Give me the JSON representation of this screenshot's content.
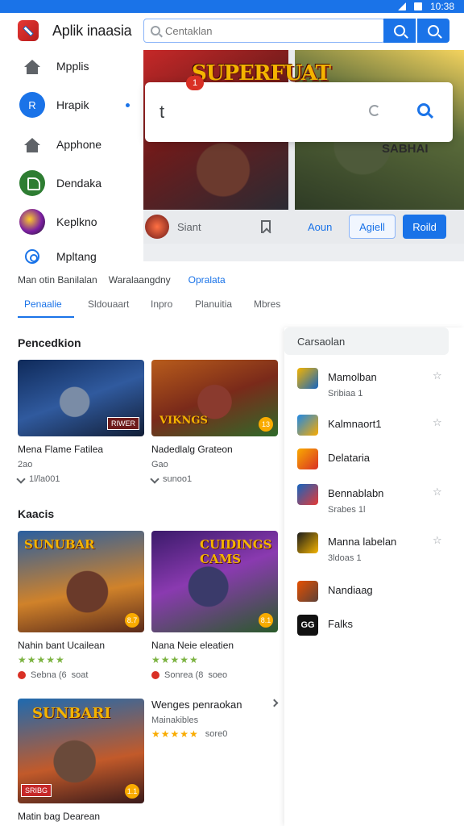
{
  "status_bar": {
    "time": "10:38"
  },
  "header": {
    "app_title": "Aplik inaasia"
  },
  "search": {
    "placeholder": "Centaklan"
  },
  "sidebar": {
    "items": [
      {
        "label": "Mpplis",
        "icon": "home-icon"
      },
      {
        "label": "Hrapik",
        "icon": "profile-circle-icon",
        "initial": "R"
      },
      {
        "label": "Apphone",
        "icon": "home-icon"
      },
      {
        "label": "Dendaka",
        "icon": "green-app-icon"
      },
      {
        "label": "Keplkno",
        "icon": "game-avatar-icon"
      },
      {
        "label": "Mpltang",
        "icon": "settings-icon"
      }
    ]
  },
  "hero": {
    "logo_text": "SUPERFUAT",
    "sub_text": "SABHAI",
    "name": "Siant",
    "link": "Aoun",
    "outline_button": "Agiell",
    "primary_button": "Roild"
  },
  "popup": {
    "badge": "1",
    "letter": "t"
  },
  "filters": [
    "Man otin Banilalan",
    "Waralaangdny",
    "Opralata"
  ],
  "tabs": [
    "Penaalie",
    "Sldouaart",
    "Inpro",
    "Planuitia",
    "Mbres"
  ],
  "sections": [
    {
      "title": "Pencedkion",
      "cards": [
        {
          "title": "Mena Flame Fatilea",
          "meta": "2ao",
          "downloads": "1l/la001",
          "tag": "RIWER"
        },
        {
          "title": "Nadedlalg Grateon",
          "meta": "Gao",
          "downloads": "sunoo1",
          "tag": "VIKNGS",
          "rating": "13"
        }
      ]
    },
    {
      "title": "Kaacis",
      "cards": [
        {
          "title": "Nahin bant Ucailean",
          "art": "SUNUBAR",
          "stars": "★★★★★",
          "rating_line": "Sebna (6",
          "extra": "soat",
          "badge": "8.7"
        },
        {
          "title": "Nana Neie eleatien",
          "art": "CUIDINGS CAMS",
          "stars": "★★★★★",
          "rating_line": "Sonrea (8",
          "extra": "soeo",
          "badge": "8.1"
        }
      ]
    }
  ],
  "bottom_card": {
    "title": "Matin bag Dearean",
    "art": "SUNBARI",
    "badge": "1.1",
    "tag": "SRIBG"
  },
  "list_row": {
    "title": "Wenges penraokan",
    "subtitle": "Mainakibles",
    "stars": "★★★★★",
    "extra": "sore0"
  },
  "side_list": {
    "header": "Carsaolan",
    "items": [
      {
        "name": "Mamolban",
        "sub": "Sribiaa 1",
        "star": "☆"
      },
      {
        "name": "Kalmnaort1",
        "sub": "",
        "star": "☆"
      },
      {
        "name": "Delataria",
        "sub": "",
        "star": ""
      },
      {
        "name": "Bennablabn",
        "sub": "Srabes 1l",
        "star": "☆"
      },
      {
        "name": "Manna labelan",
        "sub": "3ldoas 1",
        "star": "☆"
      },
      {
        "name": "Nandiaag",
        "sub": "",
        "star": ""
      },
      {
        "name": "Falks",
        "sub": "",
        "star": "",
        "icon_text": "GG"
      }
    ]
  },
  "colors": {
    "primary": "#1a73e8",
    "status_bar": "#1a73e8",
    "star_green": "#7cb342",
    "star_gold": "#f9ab00"
  }
}
